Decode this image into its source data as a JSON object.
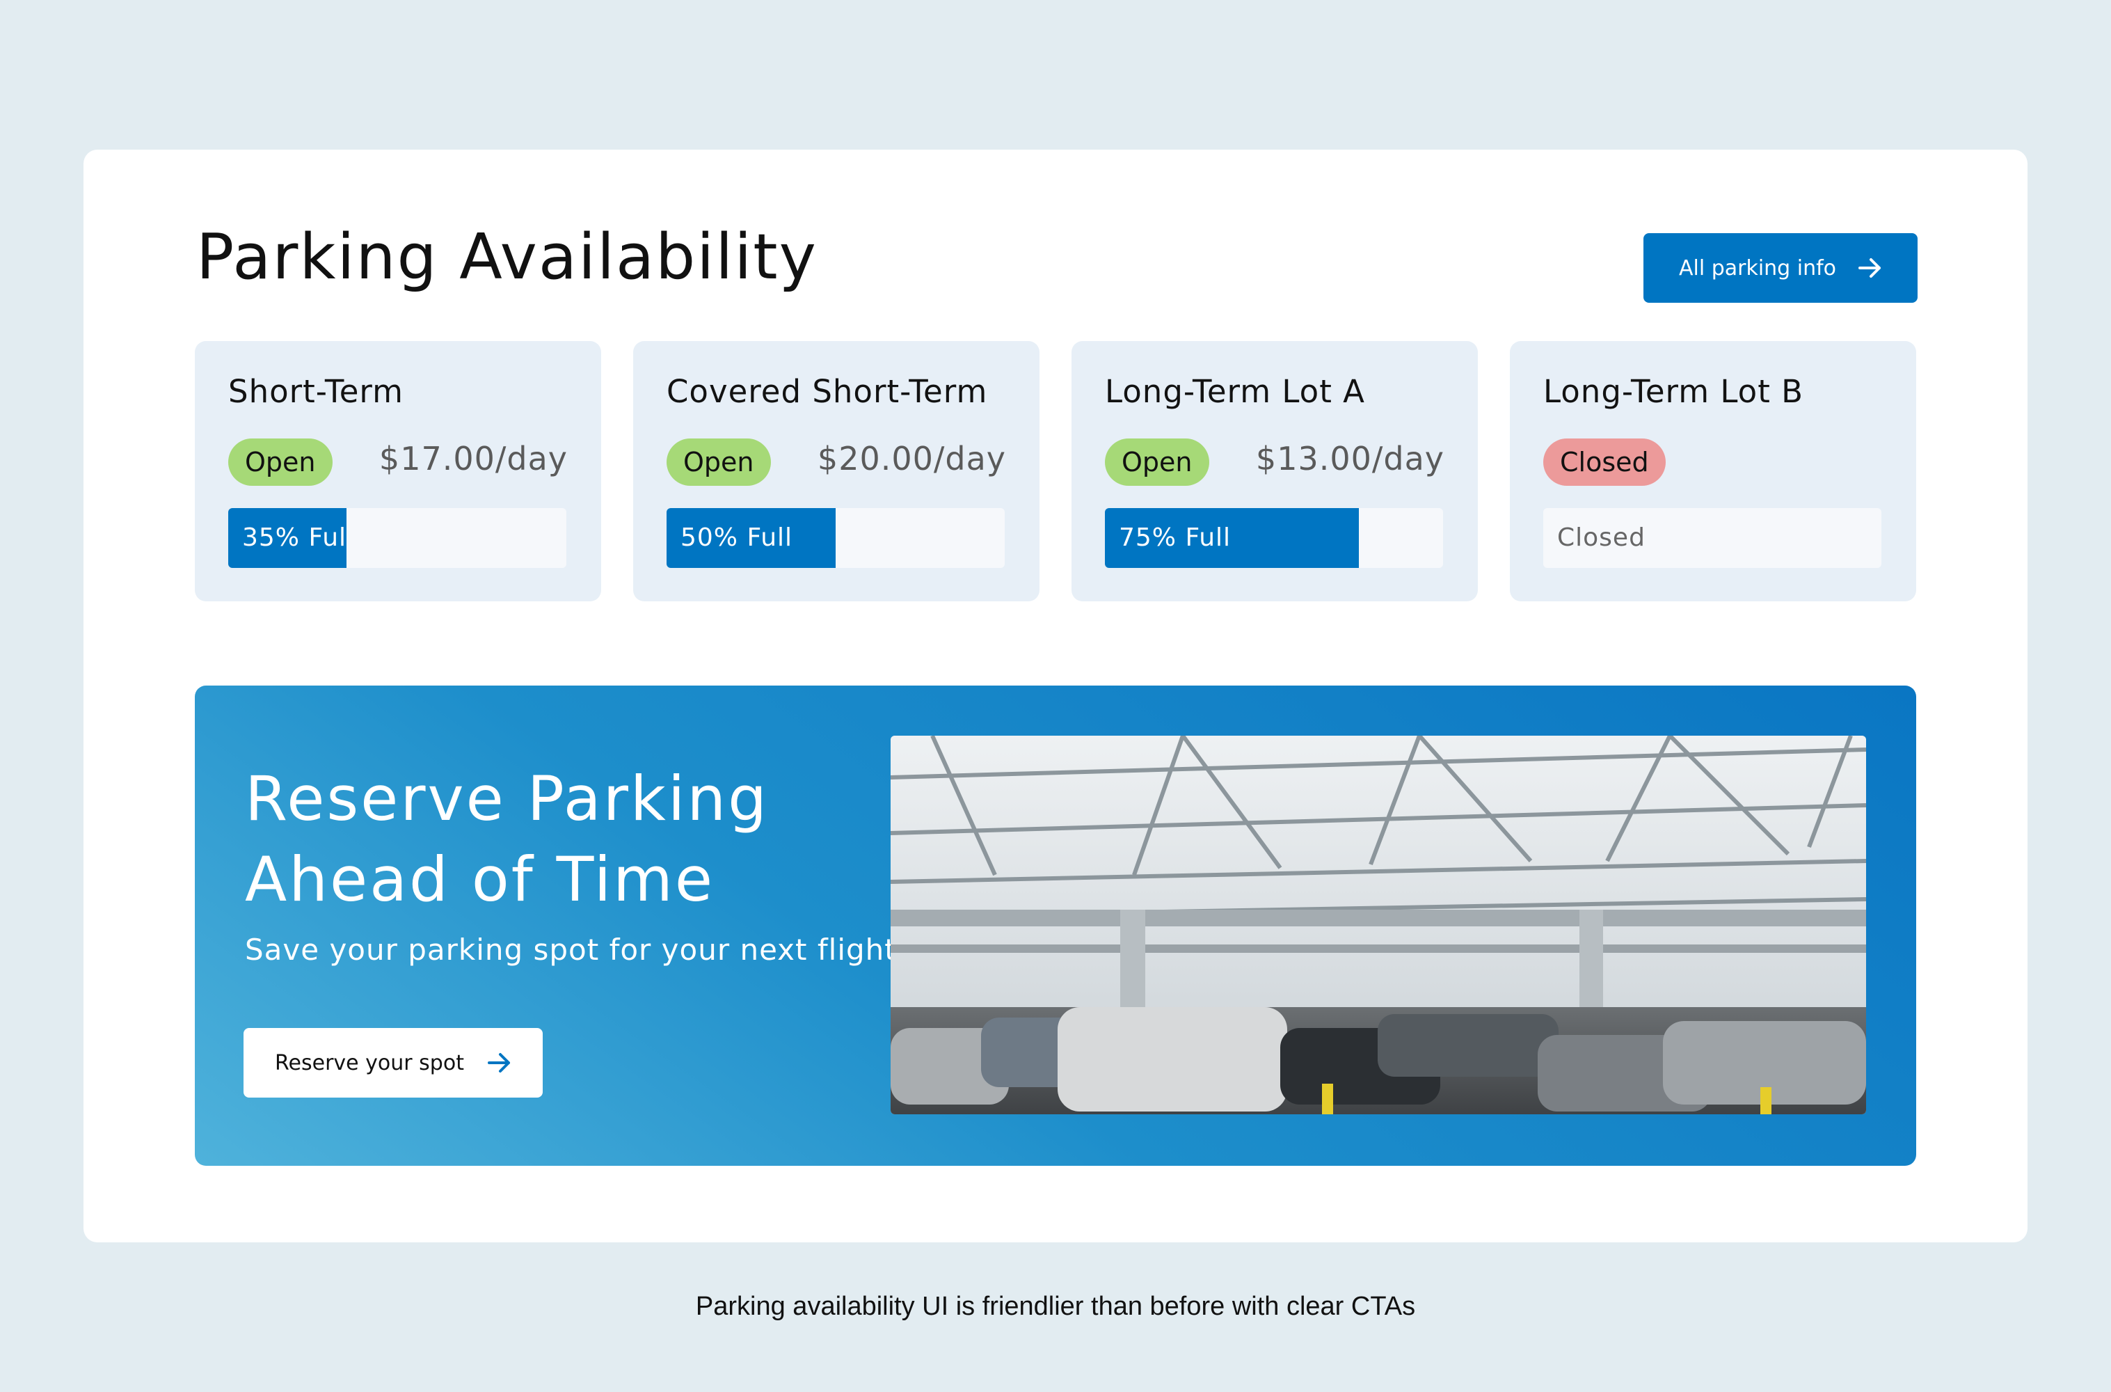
{
  "header": {
    "title": "Parking Availability",
    "info_button_label": "All parking info",
    "info_button_icon": "arrow-right-icon"
  },
  "lots": [
    {
      "name": "Short-Term",
      "status": "Open",
      "price": "$17.00/day",
      "fill_label": "35% Ful",
      "fill_percent": 35
    },
    {
      "name": "Covered Short-Term",
      "status": "Open",
      "price": "$20.00/day",
      "fill_label": "50% Full",
      "fill_percent": 50
    },
    {
      "name": "Long-Term Lot A",
      "status": "Open",
      "price": "$13.00/day",
      "fill_label": "75% Full",
      "fill_percent": 75
    },
    {
      "name": "Long-Term Lot B",
      "status": "Closed",
      "price": "",
      "fill_label": "Closed",
      "fill_percent": 0
    }
  ],
  "colors": {
    "accent": "#0075c2",
    "open_badge": "#a6d977",
    "closed_badge": "#ec9a9a",
    "card_bg": "#e7eff7",
    "page_bg": "#e2ecf1"
  },
  "promo": {
    "title_line1": "Reserve Parking",
    "title_line2": "Ahead of Time",
    "subtitle": "Save your parking spot for your next flight.",
    "button_label": "Reserve your spot",
    "button_icon": "arrow-right-icon",
    "image": "parking-garage-photo"
  },
  "caption": "Parking availability UI is friendlier than before with clear CTAs"
}
